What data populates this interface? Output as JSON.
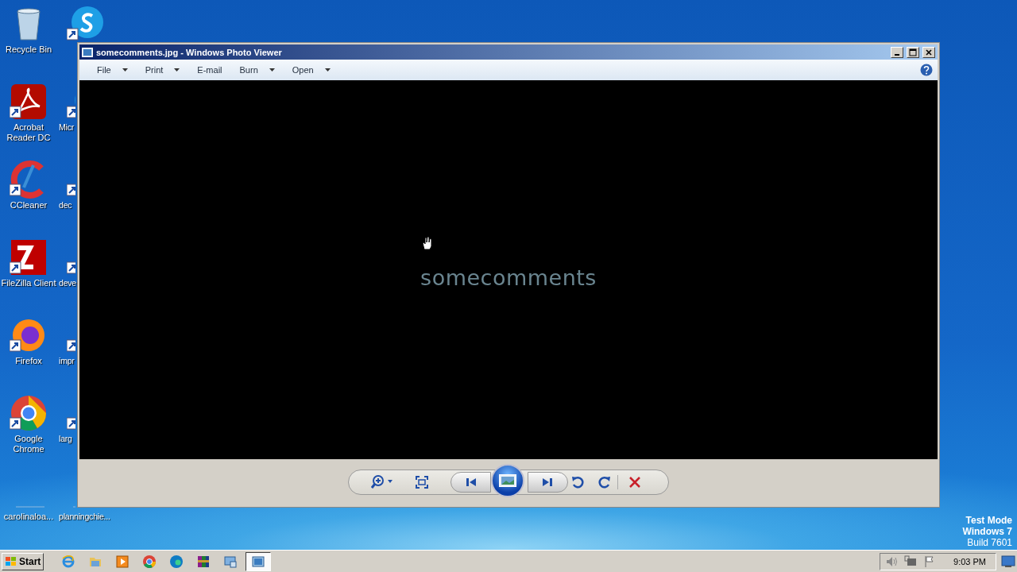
{
  "desktop": {
    "icons": [
      {
        "label": "Recycle Bin",
        "kind": "recycle"
      },
      {
        "label": "Acrobat Reader DC",
        "kind": "acrobat"
      },
      {
        "label": "CCleaner",
        "kind": "ccleaner"
      },
      {
        "label": "FileZilla Client",
        "kind": "filezilla"
      },
      {
        "label": "Firefox",
        "kind": "firefox"
      },
      {
        "label": "Google Chrome",
        "kind": "chrome"
      },
      {
        "label": "carolinaloa...",
        "kind": "blank"
      }
    ],
    "icons_col2": [
      {
        "kind": "skype"
      },
      {
        "label": "Micr",
        "kind": "edge"
      },
      {
        "label": "dec",
        "kind": "doc"
      },
      {
        "label": "deve",
        "kind": "doc"
      },
      {
        "label": "impr",
        "kind": "doc"
      },
      {
        "label": "larg",
        "kind": "doc"
      },
      {
        "label": "planningchie...",
        "kind": "blank"
      }
    ],
    "os_notice": [
      "Test Mode",
      "Windows 7",
      "Build 7601"
    ]
  },
  "window": {
    "title": "somecomments.jpg - Windows Photo Viewer",
    "menu": [
      {
        "label": "File",
        "dropdown": true
      },
      {
        "label": "Print",
        "dropdown": true
      },
      {
        "label": "E-mail",
        "dropdown": false
      },
      {
        "label": "Burn",
        "dropdown": true
      },
      {
        "label": "Open",
        "dropdown": true
      }
    ],
    "image_text": "somecomments"
  },
  "taskbar": {
    "start": "Start",
    "apps": [
      {
        "kind": "ie",
        "selected": false
      },
      {
        "kind": "folder",
        "selected": false
      },
      {
        "kind": "media",
        "selected": false
      },
      {
        "kind": "chrome",
        "selected": false
      },
      {
        "kind": "edge",
        "selected": false
      },
      {
        "kind": "winrar",
        "selected": false
      },
      {
        "kind": "remote",
        "selected": false
      },
      {
        "kind": "photo",
        "selected": true
      }
    ],
    "clock": "9:03 PM"
  }
}
